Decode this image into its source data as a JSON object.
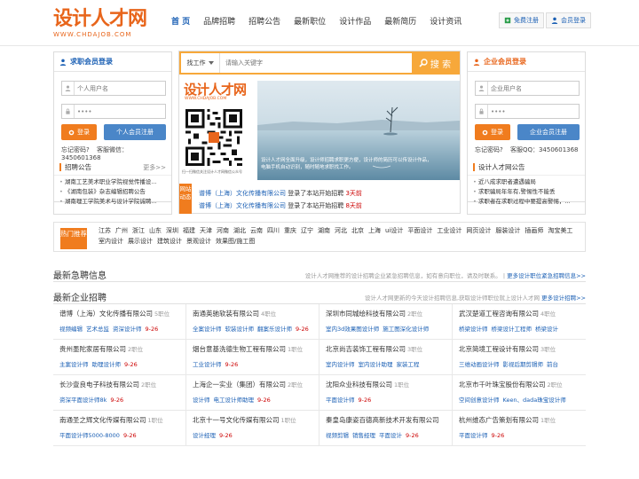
{
  "header": {
    "logo_text": "设计人才网",
    "logo_sub": "WWW.CHDAJOB.COM",
    "nav": [
      "首 页",
      "品牌招聘",
      "招聘公告",
      "最新职位",
      "设计作品",
      "最新简历",
      "设计资讯"
    ],
    "register_label": "免费注册",
    "login_label": "会员登录"
  },
  "job_login": {
    "title": "求职会员登录",
    "user_placeholder": "个人用户名",
    "password_value": "••••",
    "login_btn": "登录",
    "register_btn": "个人会员注册",
    "forgot": "忘记密码?",
    "phone": "客服微信：3450601368"
  },
  "company_login": {
    "title": "企业会员登录",
    "user_placeholder": "企业用户名",
    "password_value": "••••",
    "login_btn": "登录",
    "register_btn": "企业会员注册",
    "forgot": "忘记密码?",
    "phone": "客服QQ：3450601368"
  },
  "search": {
    "type_label": "找工作",
    "placeholder": "请输入关键字",
    "button": "搜 索"
  },
  "promo": {
    "logo": "设计人才网",
    "sub": "WWW.CHDAJOB.COM",
    "caption": "扫一扫微信关注设计人才网微信公众号"
  },
  "banner": {
    "line1": "设计人才网全面升级，设计师招聘求职更方便，设计师的简历可以传设计作品，",
    "line2": "电脑手机自动识别，随时随地求职找工作。"
  },
  "dynamic": {
    "tag": "网站动态",
    "rows": [
      {
        "company": "谱博（上海）文化传播有限公司",
        "action": "登录了本站开始招聘",
        "time": "3天前"
      },
      {
        "company": "谱博（上海）文化传播有限公司",
        "action": "登录了本站开始招聘",
        "time": "8天前"
      }
    ]
  },
  "left_news": {
    "title": "招聘公告",
    "more": "更多>>",
    "items": [
      "湖南工艺美术职业学院视觉传播设...",
      "《湖南包装》杂志编辑招聘公告",
      "湖南理工学院美术与设计学院诚聘..."
    ]
  },
  "right_news": {
    "title": "设计人才网公告",
    "items": [
      "近八成求职者遭遇骗局",
      "求职骗局年年有,警惕性不能丢",
      "求职者在求职过程中要提高警惕，..."
    ]
  },
  "hot": {
    "label": "热门推荐",
    "tags": [
      "江苏",
      "广州",
      "浙江",
      "山东",
      "深圳",
      "福建",
      "天津",
      "河南",
      "湖北",
      "云南",
      "四川",
      "重庆",
      "辽宁",
      "湖南",
      "河北",
      "北京",
      "上海",
      "ui设计",
      "平面设计",
      "工业设计",
      "网页设计",
      "服装设计",
      "插画师",
      "淘宝美工",
      "室内设计",
      "展示设计",
      "建筑设计",
      "景观设计",
      "效果图/施工图"
    ]
  },
  "urgent": {
    "title": "最新急聘信息",
    "desc": "设计人才网推荐的设计招聘企业紧急招聘信息，如有意向职位，请及时联系。",
    "more": "更多设计职位紧急招聘信息>>"
  },
  "companies_section": {
    "title": "最新企业招聘",
    "desc": "设计人才网更新的今天设计招聘信息,获取设计师职位就上设计人才网",
    "more": "更多设计招聘>>"
  },
  "companies": [
    {
      "name": "谱博（上海）文化传播有限公司",
      "count": "5职位",
      "jobs": [
        "视频编辑",
        "艺术总监",
        "资深设计师"
      ],
      "date": "9-26"
    },
    {
      "name": "南通英驰软装有限公司",
      "count": "4职位",
      "jobs": [
        "全案设计师",
        "软装设计师",
        "翻案乐设计师"
      ],
      "date": "9-26"
    },
    {
      "name": "深圳市同城绘科技有限公司",
      "count": "2职位",
      "jobs": [
        "室内3d效果图设计师",
        "施工图深化设计师"
      ],
      "date": ""
    },
    {
      "name": "武汉楚道工程咨询有限公司",
      "count": "4职位",
      "jobs": [
        "桥梁设计师",
        "桥梁设计工程师",
        "桥梁设计"
      ],
      "date": ""
    },
    {
      "name": "贵州墨陀家居有限公司",
      "count": "2职位",
      "jobs": [
        "主案设计师",
        "助理设计师"
      ],
      "date": "9-26"
    },
    {
      "name": "烟台意基洗德生物工程有限公司",
      "count": "1职位",
      "jobs": [
        "工业设计师"
      ],
      "date": "9-26"
    },
    {
      "name": "北京尚吉装饰工程有限公司",
      "count": "3职位",
      "jobs": [
        "室内设计师",
        "室内设计助理",
        "家装工程"
      ],
      "date": ""
    },
    {
      "name": "北京简境工程设计有限公司",
      "count": "3职位",
      "jobs": [
        "三维动画设计师",
        "影视后期剪辑师",
        "前台"
      ],
      "date": ""
    },
    {
      "name": "长沙壹良电子科技有限公司",
      "count": "2职位",
      "jobs": [
        "资深平面设计师8k"
      ],
      "date": "9-26"
    },
    {
      "name": "上海企一实业（集团）有限公司",
      "count": "2职位",
      "jobs": [
        "设计师",
        "电工设计师助理"
      ],
      "date": "9-26"
    },
    {
      "name": "沈阳众业科技有限公司",
      "count": "1职位",
      "jobs": [
        "平面设计师"
      ],
      "date": "9-26"
    },
    {
      "name": "北京市千叶珠宝股份有限公司",
      "count": "2职位",
      "jobs": [
        "空间创意设计师",
        "Keen、dada珠宝设计师"
      ],
      "date": ""
    },
    {
      "name": "南通圣之辉文化传媒有限公司",
      "count": "1职位",
      "jobs": [
        "平面设计师5000-8000"
      ],
      "date": "9-26"
    },
    {
      "name": "北京十一号文化传媒有限公司",
      "count": "1职位",
      "jobs": [
        "设计经理"
      ],
      "date": "9-26"
    },
    {
      "name": "秦皇岛康姿百德高新技术开发有限公司",
      "count": "",
      "jobs": [
        "视频剪辑",
        "销售经理",
        "平面设计"
      ],
      "date": "9-26"
    },
    {
      "name": "杭州维态广告策划有限公司",
      "count": "1职位",
      "jobs": [
        "平面设计师"
      ],
      "date": "9-26"
    }
  ]
}
